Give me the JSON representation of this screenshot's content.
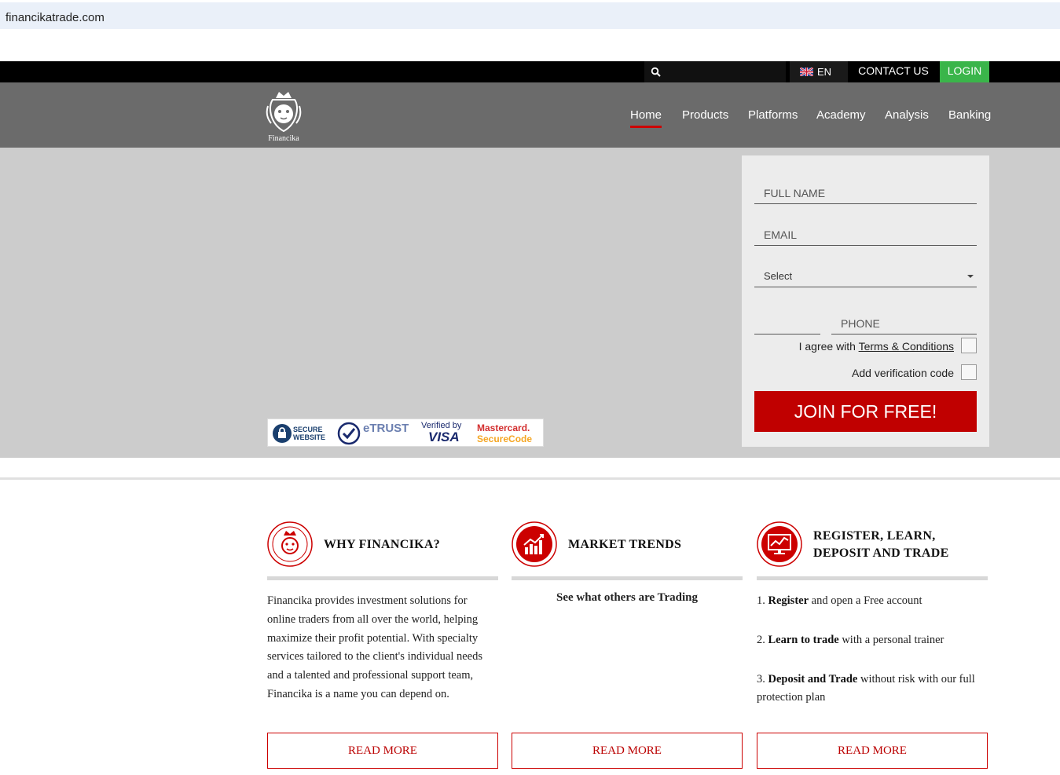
{
  "browser": {
    "url": "financikatrade.com"
  },
  "topbar": {
    "language": "EN",
    "contact_label": "CONTACT US",
    "login_label": "LOGIN",
    "login_color": "#3ab54a"
  },
  "nav": {
    "logo_text": "Financika",
    "items": [
      {
        "label": "Home"
      },
      {
        "label": "Products"
      },
      {
        "label": "Platforms"
      },
      {
        "label": "Academy"
      },
      {
        "label": "Analysis"
      },
      {
        "label": "Banking"
      }
    ]
  },
  "badges": {
    "secure": [
      "SECURE",
      "WEBSITE"
    ],
    "etrust": "eTRUST",
    "visa": [
      "Verified by",
      "VISA"
    ],
    "mastercard": [
      "Mastercard.",
      "SecureCode"
    ]
  },
  "form": {
    "full_name_placeholder": "FULL NAME",
    "email_placeholder": "EMAIL",
    "select_label": "Select",
    "phone_placeholder": "PHONE",
    "agree_prefix": "I agree with ",
    "terms_link": "Terms & Conditions",
    "verification_label": "Add verification code",
    "join_label": "JOIN FOR FREE!",
    "join_color": "#c00000"
  },
  "columns": [
    {
      "title": "WHY FINANCIKA?",
      "body": "Financika provides investment solutions for online traders from all over the world, helping maximize their profit potential. With specialty services tailored to the client's individual needs and a talented and professional support team, Financika is a name you can depend on.",
      "button": "READ MORE"
    },
    {
      "title": "MARKET TRENDS",
      "subtitle": "See what others are Trading",
      "button": "READ MORE"
    },
    {
      "title_line1": "REGISTER, LEARN,",
      "title_line2": "DEPOSIT AND TRADE",
      "steps": [
        {
          "num": "1.",
          "bold": "Register",
          "rest": " and open a Free account"
        },
        {
          "num": "2.",
          "bold": "Learn to trade",
          "rest": " with a personal trainer"
        },
        {
          "num": "3.",
          "bold": "Deposit and Trade",
          "rest": " without risk with our full protection plan"
        }
      ],
      "button": "READ MORE"
    }
  ],
  "accent_color": "#cc0000"
}
